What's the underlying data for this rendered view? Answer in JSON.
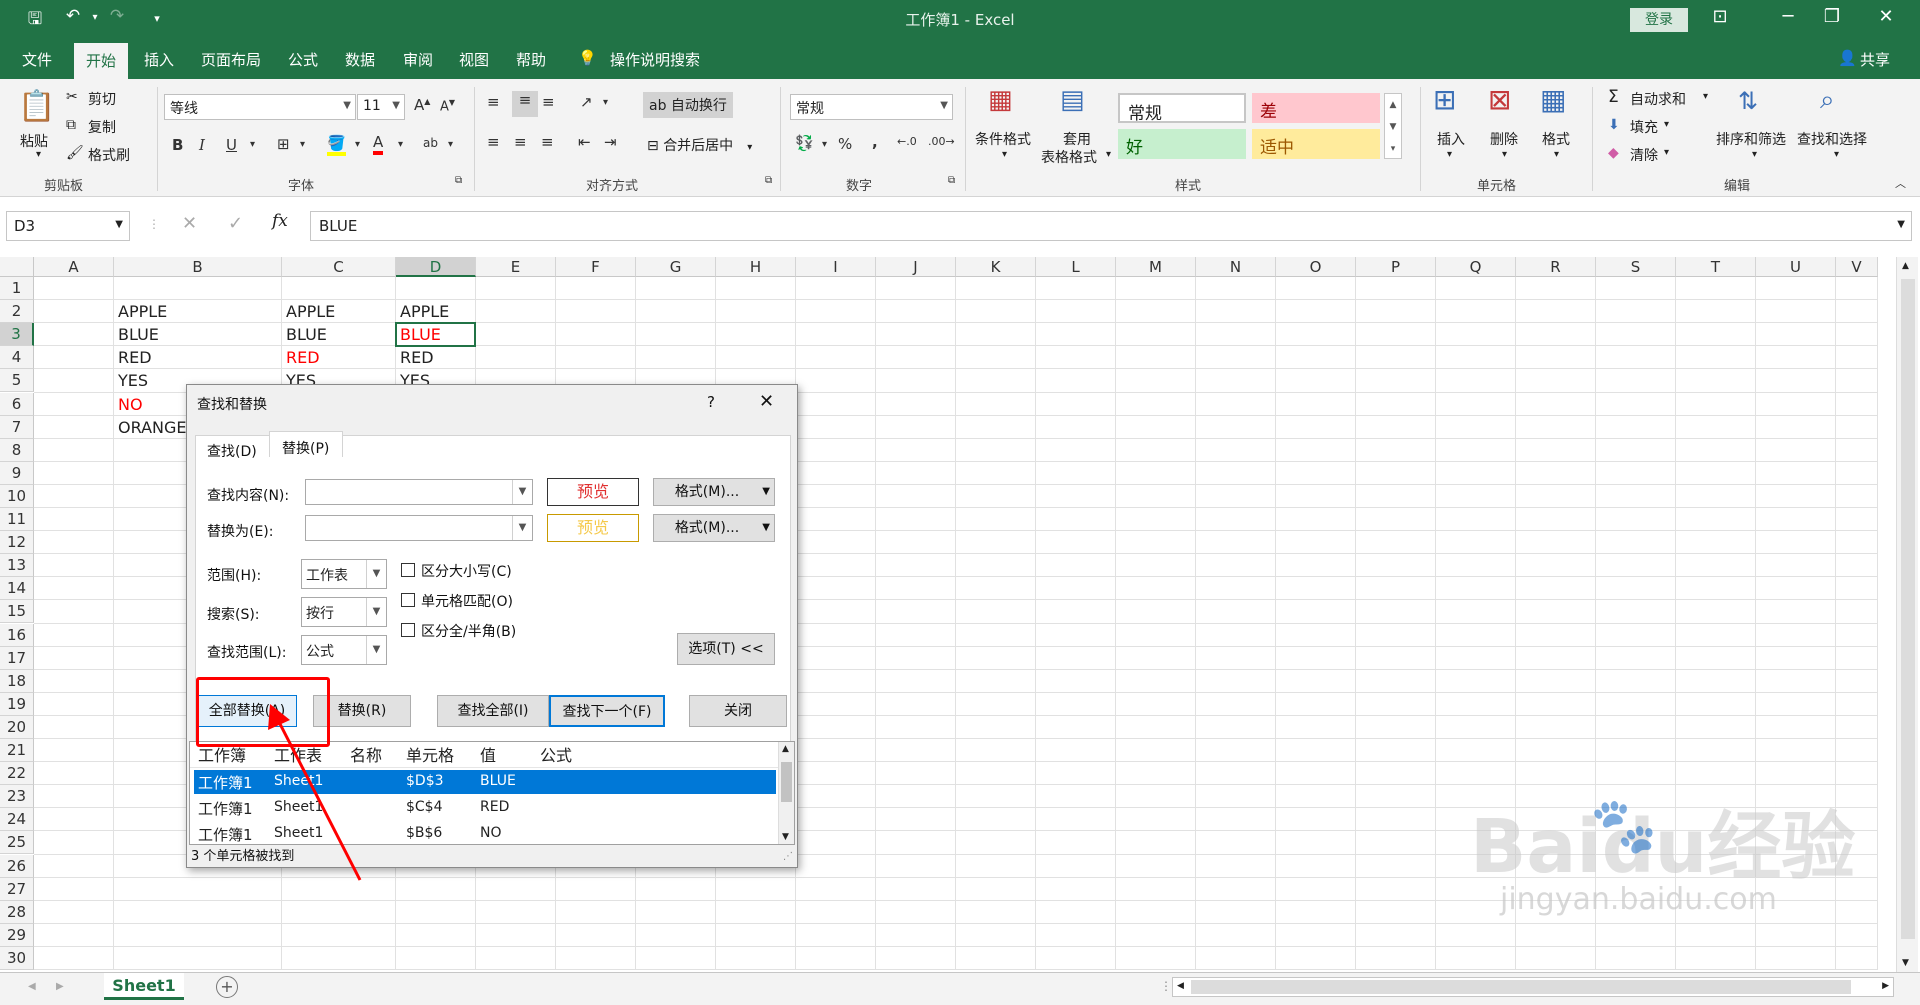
{
  "window": {
    "title": "工作簿1  -  Excel",
    "login": "登录",
    "share": "共享"
  },
  "tabs": [
    "文件",
    "开始",
    "插入",
    "页面布局",
    "公式",
    "数据",
    "审阅",
    "视图",
    "帮助",
    "操作说明搜索"
  ],
  "ribbon": {
    "clipboard": {
      "paste": "粘贴",
      "cut": "剪切",
      "copy": "复制",
      "format_painter": "格式刷",
      "label": "剪贴板"
    },
    "font": {
      "name": "等线",
      "size": "11",
      "label": "字体",
      "bold": "B",
      "italic": "I",
      "underline": "U",
      "grow": "A",
      "shrink": "A"
    },
    "alignment": {
      "wrap": "自动换行",
      "merge": "合并后居中",
      "label": "对齐方式"
    },
    "number": {
      "format": "常规",
      "label": "数字",
      "percent": "%",
      "comma": ","
    },
    "styles": {
      "cond_format": "条件格式",
      "table_format_1": "套用",
      "table_format_2": "表格格式",
      "normal": "常规",
      "bad": "差",
      "good": "好",
      "neutral": "适中",
      "label": "样式"
    },
    "cells": {
      "insert": "插入",
      "delete": "删除",
      "format": "格式",
      "label": "单元格"
    },
    "editing": {
      "autosum": "自动求和",
      "fill": "填充",
      "clear": "清除",
      "sort": "排序和筛选",
      "find": "查找和选择",
      "label": "编辑"
    }
  },
  "formula_bar": {
    "name_box": "D3",
    "fx": "fx",
    "value": "BLUE"
  },
  "columns": [
    "A",
    "B",
    "C",
    "D",
    "E",
    "F",
    "G",
    "H",
    "I",
    "J",
    "K",
    "L",
    "M",
    "N",
    "O",
    "P",
    "Q",
    "R",
    "S",
    "T",
    "U",
    "V"
  ],
  "rows": [
    "1",
    "2",
    "3",
    "4",
    "5",
    "6",
    "7",
    "8",
    "9",
    "10",
    "11",
    "12",
    "13",
    "14",
    "15",
    "16",
    "17",
    "18",
    "19",
    "20",
    "21",
    "22",
    "23",
    "24",
    "25",
    "26",
    "27",
    "28",
    "29",
    "30"
  ],
  "cells": {
    "B2": "APPLE",
    "C2": "APPLE",
    "D2": "APPLE",
    "B3": "BLUE",
    "C3": "BLUE",
    "D3": "BLUE",
    "B4": "RED",
    "C4": "RED",
    "D4": "RED",
    "B5": "YES",
    "C5": "YES",
    "D5": "YES",
    "B6": "NO",
    "B7": "ORANGE"
  },
  "highlight_color": "#ff0000",
  "sheet_tab": "Sheet1",
  "dialog": {
    "title": "查找和替换",
    "help": "?",
    "tab_find": "查找(D)",
    "tab_replace": "替换(P)",
    "find_what": "查找内容(N):",
    "replace_with": "替换为(E):",
    "preview1": "预览",
    "preview2": "预览",
    "format1": "格式(M)...",
    "format2": "格式(M)...",
    "within_label": "范围(H):",
    "within_value": "工作表",
    "search_label": "搜索(S):",
    "search_value": "按行",
    "lookin_label": "查找范围(L):",
    "lookin_value": "公式",
    "match_case": "区分大小写(C)",
    "match_entire": "单元格匹配(O)",
    "match_byte": "区分全/半角(B)",
    "options": "选项(T) <<",
    "replace_all": "全部替换(A)",
    "replace": "替换(R)",
    "find_all": "查找全部(I)",
    "find_next": "查找下一个(F)",
    "close": "关闭",
    "results_headers": [
      "工作簿",
      "工作表",
      "名称",
      "单元格",
      "值",
      "公式"
    ],
    "results": [
      {
        "book": "工作簿1",
        "sheet": "Sheet1",
        "cell": "$D$3",
        "value": "BLUE"
      },
      {
        "book": "工作簿1",
        "sheet": "Sheet1",
        "cell": "$C$4",
        "value": "RED"
      },
      {
        "book": "工作簿1",
        "sheet": "Sheet1",
        "cell": "$B$6",
        "value": "NO"
      }
    ],
    "status": "3 个单元格被找到"
  },
  "watermark": "Baidu经验",
  "watermark_url": "jingyan.baidu.com"
}
